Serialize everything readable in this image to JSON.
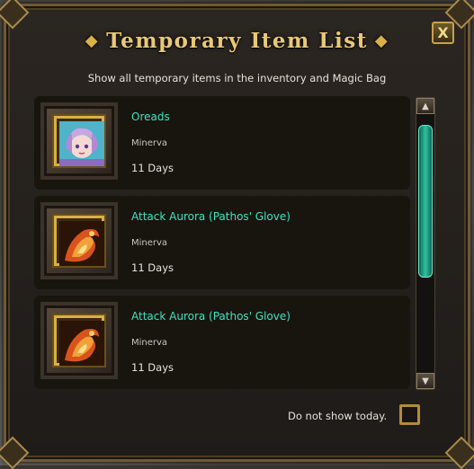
{
  "window": {
    "title": "Temporary Item List",
    "subtitle": "Show all temporary items in the inventory and Magic Bag",
    "close_label": "X"
  },
  "items": [
    {
      "name": "Oreads",
      "owner": "Minerva",
      "duration": "11 Days",
      "icon": "fairy-portrait-icon"
    },
    {
      "name": "Attack Aurora (Pathos' Glove)",
      "owner": "Minerva",
      "duration": "11 Days",
      "icon": "flaming-glove-icon"
    },
    {
      "name": "Attack Aurora (Pathos' Glove)",
      "owner": "Minerva",
      "duration": "11 Days",
      "icon": "flaming-glove-icon"
    }
  ],
  "scrollbar": {
    "up": "▲",
    "down": "▼"
  },
  "footer": {
    "dont_show_label": "Do not show today.",
    "checked": false
  },
  "colors": {
    "title": "#e8c878",
    "item_name": "#3fe3c0",
    "scroll_thumb": "#2fc1a0"
  }
}
